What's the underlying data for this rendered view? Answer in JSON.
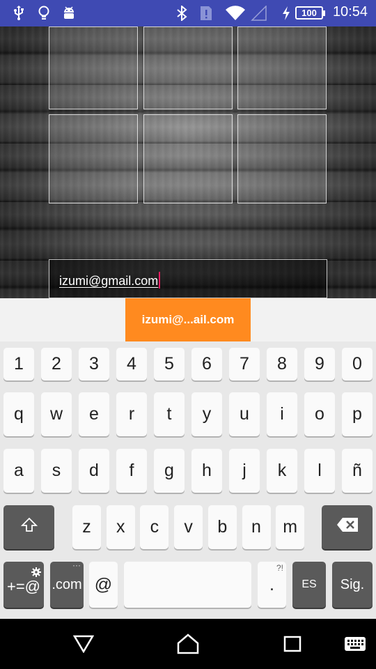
{
  "status_bar": {
    "icons_left": [
      "usb-icon",
      "bulb-icon",
      "android-icon"
    ],
    "icons_right": [
      "bluetooth-icon",
      "alert-icon",
      "wifi-icon",
      "no-signal-icon",
      "charging-icon"
    ],
    "battery": "100",
    "time": "10:54",
    "background": "#3f4ab3"
  },
  "login": {
    "email_value": "izumi@gmail.com"
  },
  "suggestion": {
    "text": "izumi@...ail.com",
    "color": "#ff8a1f"
  },
  "keyboard": {
    "numbers": [
      "1",
      "2",
      "3",
      "4",
      "5",
      "6",
      "7",
      "8",
      "9",
      "0"
    ],
    "row1": [
      "q",
      "w",
      "e",
      "r",
      "t",
      "y",
      "u",
      "i",
      "o",
      "p"
    ],
    "row2": [
      "a",
      "s",
      "d",
      "f",
      "g",
      "h",
      "j",
      "k",
      "l",
      "ñ"
    ],
    "row3": [
      "z",
      "x",
      "c",
      "v",
      "b",
      "n",
      "m"
    ],
    "symbols_label": "+=@",
    "dotcom_label": ".com",
    "dotcom_hint": "···",
    "at_label": "@",
    "period_label": ".",
    "period_hint": "?!",
    "language_label": "ES",
    "next_label": "Sig."
  },
  "nav": {
    "icons": [
      "back-icon",
      "home-icon",
      "recents-icon",
      "keyboard-switch-icon"
    ]
  }
}
